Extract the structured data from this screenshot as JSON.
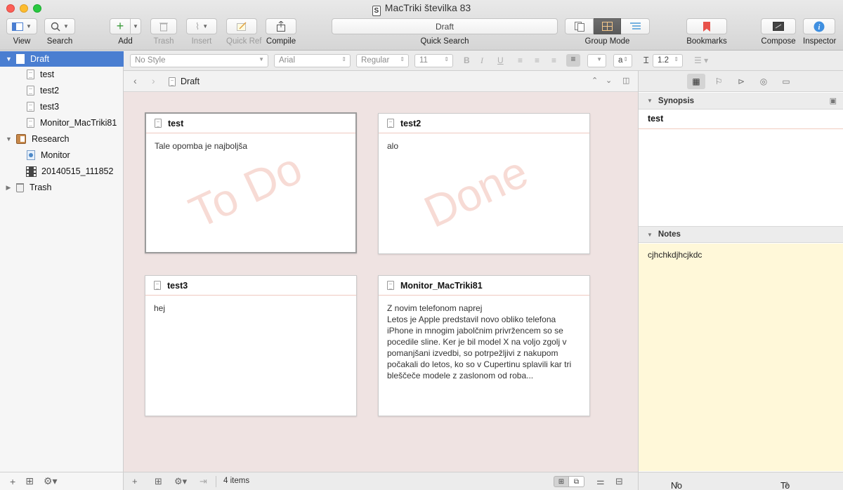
{
  "window": {
    "title": "MacTriki številka 83",
    "title_icon": "scrivener-doc-icon"
  },
  "toolbar": {
    "view_label": "View",
    "search_label": "Search",
    "add_label": "Add",
    "trash_label": "Trash",
    "insert_label": "Insert",
    "quickref_label": "Quick Ref",
    "compile_label": "Compile",
    "quicksearch_value": "Draft",
    "quicksearch_label": "Quick Search",
    "groupmode_label": "Group Mode",
    "bookmarks_label": "Bookmarks",
    "compose_label": "Compose",
    "inspector_label": "Inspector",
    "groupmode_active": "corkboard"
  },
  "formatbar": {
    "style": "No Style",
    "font": "Arial",
    "weight": "Regular",
    "size": "11",
    "line_spacing": "1.2",
    "bold": "B",
    "italic": "I",
    "underline": "U",
    "highlight": "a"
  },
  "binder": {
    "items": [
      {
        "label": "Draft",
        "icon": "draft-icon",
        "selected": true,
        "expanded": true
      },
      {
        "label": "test",
        "icon": "page-icon"
      },
      {
        "label": "test2",
        "icon": "page-icon"
      },
      {
        "label": "test3",
        "icon": "page-icon"
      },
      {
        "label": "Monitor_MacTriki81",
        "icon": "page-icon"
      },
      {
        "label": "Research",
        "icon": "research-folder-icon",
        "expanded": true
      },
      {
        "label": "Monitor",
        "icon": "web-page-icon"
      },
      {
        "label": "20140515_111852",
        "icon": "film-icon"
      },
      {
        "label": "Trash",
        "icon": "trash-icon",
        "expanded": false
      }
    ]
  },
  "editor": {
    "header_title": "Draft",
    "item_count": "4 items",
    "cards": [
      {
        "title": "test",
        "body": "Tale opomba je najboljša",
        "stamp": "To Do",
        "focused": true
      },
      {
        "title": "test2",
        "body": "alo",
        "stamp": "Done"
      },
      {
        "title": "test3",
        "body": "hej",
        "stamp": ""
      },
      {
        "title": "Monitor_MacTriki81",
        "body": "Z novim telefonom naprej\nLetos je Apple predstavil novo obliko telefona iPhone in mnogim jabolčnim privržencem so se pocedile sline. Ker je bil model X na voljo zgolj v pomanjšani izvedbi, so potrpežljivi z nakupom počakali do letos, ko so v Cupertinu splavili kar tri bleščeče modele z zaslonom od roba...",
        "stamp": ""
      }
    ]
  },
  "inspector": {
    "synopsis_heading": "Synopsis",
    "synopsis_title": "test",
    "notes_heading": "Notes",
    "notes_text": "cjhchkdjhcjkdc",
    "label_value": "No Label",
    "status_value": "To Do"
  },
  "colors": {
    "selection": "#4a7ed1",
    "corkboard": "#efe3e2",
    "notes_bg": "#fff8d9",
    "stamp": "#eba99b"
  }
}
